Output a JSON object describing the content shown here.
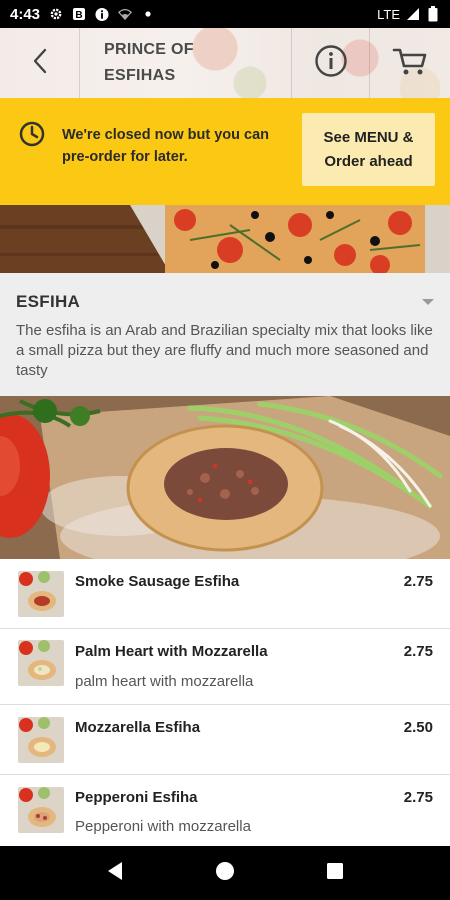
{
  "status_bar": {
    "time": "4:43",
    "network": "LTE"
  },
  "header": {
    "title_line1": "PRINCE OF",
    "title_line2": "ESFIHAS"
  },
  "banner": {
    "message": "We're closed now but you can pre-order for later.",
    "button_label": "See MENU & Order ahead",
    "color": "#fbc814"
  },
  "category": {
    "title": "ESFIHA",
    "description": "The esfiha is an Arab and Brazilian specialty mix that looks like a small pizza but they are fluffy and much more seasoned and tasty"
  },
  "menu_items": [
    {
      "name": "Smoke Sausage Esfiha",
      "price": "2.75",
      "description": ""
    },
    {
      "name": "Palm Heart with Mozzarella",
      "price": "2.75",
      "description": "palm heart with mozzarella"
    },
    {
      "name": "Mozzarella Esfiha",
      "price": "2.50",
      "description": ""
    },
    {
      "name": "Pepperoni Esfiha",
      "price": "2.75",
      "description": "Pepperoni with mozzarella"
    }
  ],
  "icons": {
    "back": "back-arrow-icon",
    "info": "info-icon",
    "cart": "cart-icon",
    "clock": "clock-icon"
  }
}
